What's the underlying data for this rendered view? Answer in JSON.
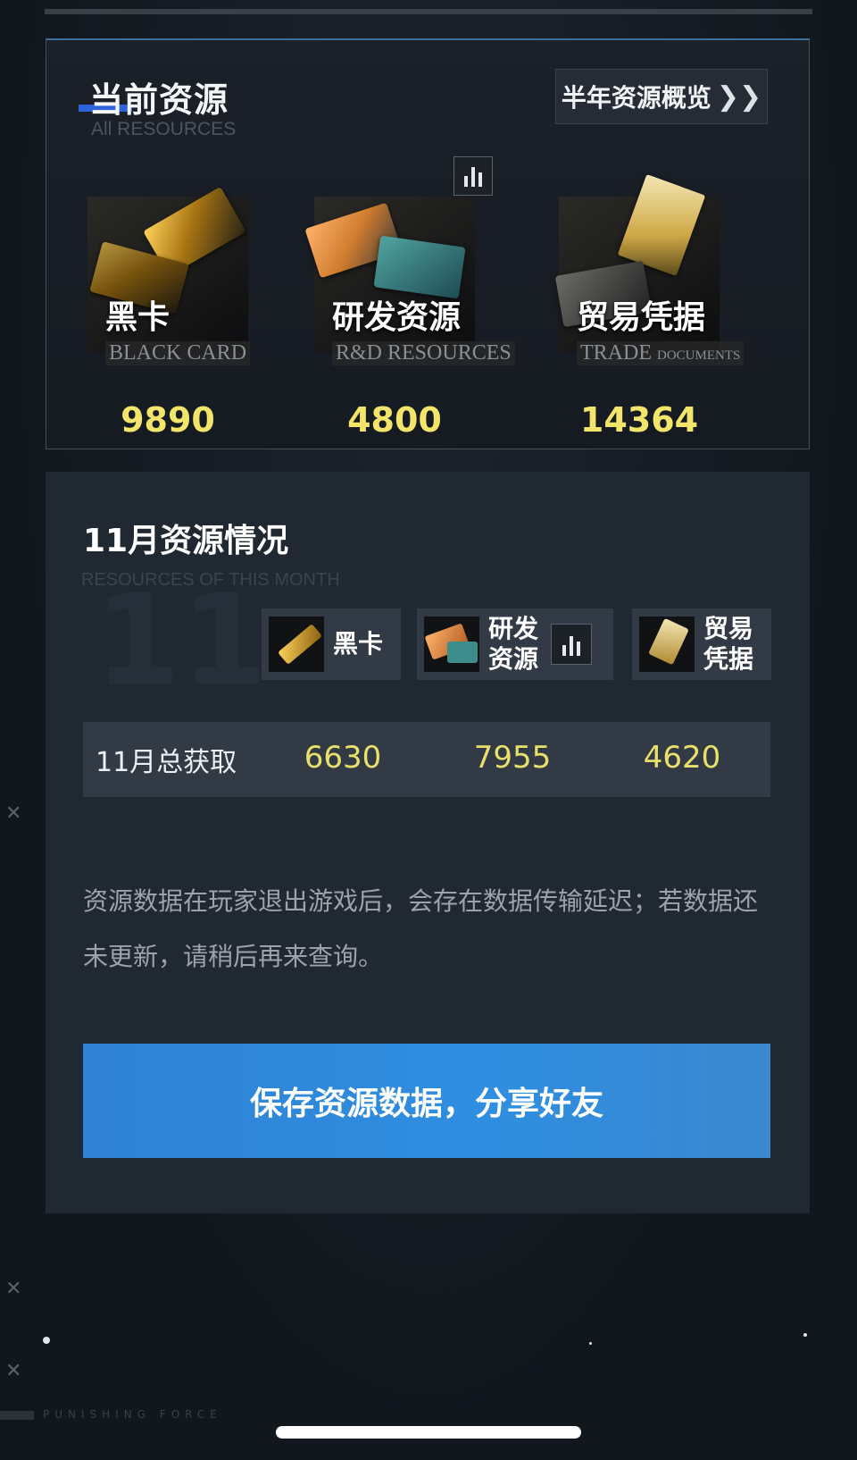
{
  "current": {
    "title": "当前资源",
    "subtitle": "All RESOURCES",
    "overview_button": "半年资源概览",
    "resources": [
      {
        "cn": "黑卡",
        "en": "BLACK CARD",
        "value": "9890"
      },
      {
        "cn": "研发资源",
        "en": "R&D RESOURCES",
        "value": "4800"
      },
      {
        "cn": "贸易凭据",
        "en_main": "TRADE",
        "en_small": "DOCUMENTS",
        "value": "14364"
      }
    ]
  },
  "month": {
    "title": "11月资源情况",
    "subtitle": "RESOURCES OF THIS MONTH",
    "big_number": "11",
    "columns": [
      {
        "label": "黑卡"
      },
      {
        "label1": "研发",
        "label2": "资源"
      },
      {
        "label1": "贸易",
        "label2": "凭据"
      }
    ],
    "total_row": {
      "label": "11月总获取",
      "values": [
        "6630",
        "7955",
        "4620"
      ]
    },
    "note": "资源数据在玩家退出游戏后，会存在数据传输延迟；若数据还未更新，请稍后再来查询。",
    "save_button": "保存资源数据，分享好友"
  },
  "footer": {
    "brand": "PUNISHING FORCE"
  },
  "colors": {
    "accent_blue": "#2f82d4",
    "value_yellow": "#f2e56a",
    "panel_bg": "#202832"
  },
  "icons": [
    "chevron-double-right-icon",
    "bar-chart-icon",
    "close-icon"
  ]
}
